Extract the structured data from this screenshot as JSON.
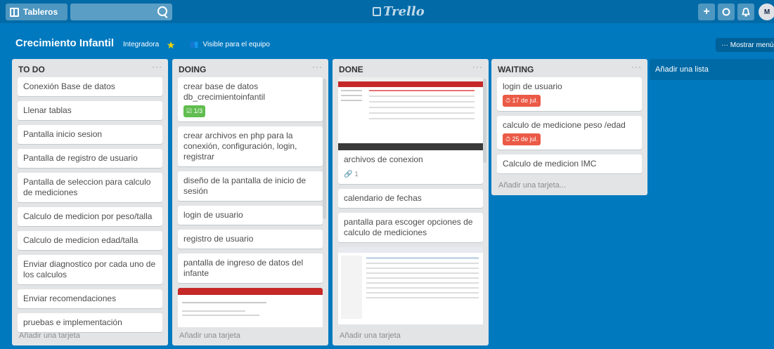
{
  "topbar": {
    "boards_label": "Tableros",
    "search": {
      "value": "",
      "placeholder": ""
    },
    "logo": "Trello",
    "add_icon": "+",
    "info_icon": "⓪",
    "bell_icon": "bell",
    "avatar_initials": "M"
  },
  "board": {
    "title": "Crecimiento Infantil",
    "team": "Integradora",
    "visibility": "Visible para el equipo",
    "menu_label": "··· Mostrar menú"
  },
  "lists": {
    "todo": {
      "title": "TO DO",
      "cards": [
        "Conexión Base de datos",
        "Llenar tablas",
        "Pantalla inicio sesion",
        "Pantalla de registro de usuario",
        "Pantalla de seleccion para calculo de mediciones",
        "Calculo de medicion por peso/talla",
        "Calculo de medicion edad/talla",
        "Enviar diagnostico por cada uno de los calculos",
        "Enviar recomendaciones",
        "pruebas e implementación"
      ],
      "add_card": "Añadir una tarjeta"
    },
    "doing": {
      "title": "DOING",
      "cards": [
        "crear base de datos db_crecimientoinfantil",
        "crear archivos en php para la conexión, configuración, login, registrar",
        "diseño de la pantalla de inicio de sesión",
        "login de usuario",
        "registro de usuario",
        "pantalla de ingreso de datos del infante"
      ],
      "checklist_badge": "1/3",
      "add_card": "Añadir una tarjeta"
    },
    "done": {
      "title": "DONE",
      "cards": [
        "archivos de conexion",
        "calendario de fechas",
        "pantalla para escoger opciones de calculo de mediciones"
      ],
      "attachment_count": "1",
      "add_card": "Añadir una tarjeta"
    },
    "waiting": {
      "title": "WAITING",
      "cards": [
        "login de usuario",
        "calculo de medicione peso /edad",
        "Calculo de medicion IMC"
      ],
      "due_1": "17 de jul.",
      "due_2": "25 de jul.",
      "add_card": "Añadir una tarjeta..."
    }
  },
  "add_list": "Añadir una lista",
  "colors": {
    "board_bg": "#0079bf",
    "topbar_bg": "#026aa7",
    "list_bg": "#e2e4e6",
    "green": "#61bd4f",
    "red": "#eb5a46"
  }
}
